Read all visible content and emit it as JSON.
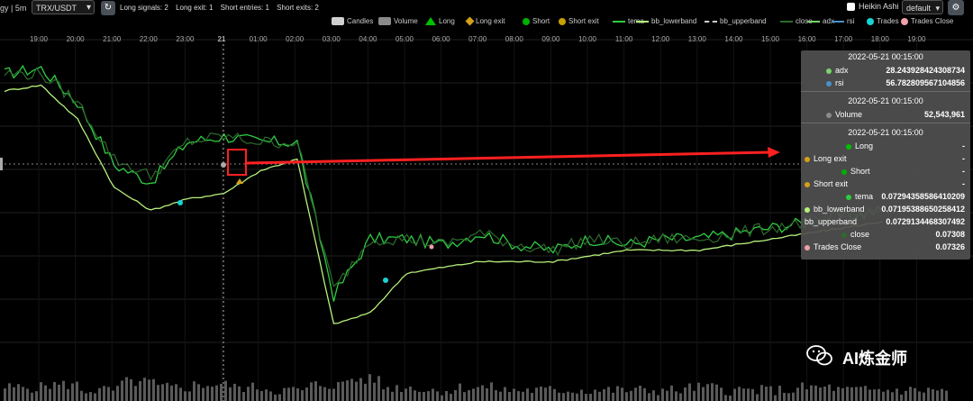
{
  "topbar": {
    "strategy_fragment": "gy | 5m",
    "pair": "TRX/USDT",
    "stats": [
      "Long signals: 2",
      "Long exit: 1",
      "Short entries: 1",
      "Short exits: 2"
    ],
    "heikin_label": "Heikin Ashi",
    "theme_select": "default"
  },
  "legend": [
    {
      "label": "Candles",
      "color": "#d0d0d0",
      "kind": "box"
    },
    {
      "label": "Volume",
      "color": "#8a8a8a",
      "kind": "box"
    },
    {
      "label": "Long",
      "color": "#00c000",
      "kind": "tri"
    },
    {
      "label": "Long exit",
      "color": "#d4a017",
      "kind": "diamond"
    },
    {
      "label": "Short",
      "color": "#00b000",
      "kind": "circle"
    },
    {
      "label": "Short exit",
      "color": "#c8a000",
      "kind": "circle"
    },
    {
      "label": "tema",
      "color": "#2ecc40",
      "kind": "line"
    },
    {
      "label": "bb_lowerband",
      "color": "#b6f07a",
      "kind": "line"
    },
    {
      "label": "bb_upperband",
      "color": "#cccccc",
      "kind": "dash"
    },
    {
      "label": "close",
      "color": "#2d6a2d",
      "kind": "line"
    },
    {
      "label": "adx",
      "color": "#7ad36b",
      "kind": "line"
    },
    {
      "label": "rsi",
      "color": "#4a90c8",
      "kind": "line"
    },
    {
      "label": "Trades",
      "color": "#19d3d3",
      "kind": "circle"
    },
    {
      "label": "Trades Close",
      "color": "#f0a0a8",
      "kind": "circle"
    }
  ],
  "time_axis": [
    "19:00",
    "20:00",
    "21:00",
    "22:00",
    "23:00",
    "21",
    "01:00",
    "02:00",
    "03:00",
    "04:00",
    "05:00",
    "06:00",
    "07:00",
    "08:00",
    "09:00",
    "10:00",
    "11:00",
    "12:00",
    "13:00",
    "14:00",
    "15:00",
    "16:00",
    "17:00",
    "18:00",
    "19:00"
  ],
  "tooltip": {
    "sections": [
      {
        "timestamp": "2022-05-21 00:15:00",
        "rows": [
          {
            "label": "adx",
            "value": "28.243928424308734",
            "color": "#7ad36b"
          },
          {
            "label": "rsi",
            "value": "56.782809567104856",
            "color": "#4a90c8"
          }
        ]
      },
      {
        "timestamp": "2022-05-21 00:15:00",
        "rows": [
          {
            "label": "Volume",
            "value": "52,543,961",
            "color": "#8a8a8a"
          }
        ]
      },
      {
        "timestamp": "2022-05-21 00:15:00",
        "rows": [
          {
            "label": "Long",
            "value": "-",
            "color": "#00c000"
          },
          {
            "label": "Long exit",
            "value": "-",
            "color": "#d4a017"
          },
          {
            "label": "Short",
            "value": "-",
            "color": "#00b000"
          },
          {
            "label": "Short exit",
            "value": "-",
            "color": "#d4a017"
          },
          {
            "label": "tema",
            "value": "0.07294358586410209",
            "color": "#2ecc40"
          },
          {
            "label": "bb_lowerband",
            "value": "0.07195388650258412",
            "color": "#b6f07a"
          },
          {
            "label": "bb_upperband",
            "value": "0.0729134468307492",
            "color": ""
          },
          {
            "label": "close",
            "value": "0.07308",
            "color": "#2d6a2d"
          },
          {
            "label": "Trades Close",
            "value": "0.07326",
            "color": "#f0a0a8"
          }
        ]
      }
    ]
  },
  "watermark": "AI炼金师",
  "chart_data": {
    "type": "line",
    "x_labels": [
      "19:00",
      "20:00",
      "21:00",
      "22:00",
      "23:00",
      "21",
      "01:00",
      "02:00",
      "03:00",
      "04:00",
      "05:00",
      "06:00",
      "07:00",
      "08:00",
      "09:00",
      "10:00",
      "11:00",
      "12:00",
      "13:00",
      "14:00",
      "15:00",
      "16:00",
      "17:00",
      "18:00",
      "19:00"
    ],
    "series": [
      {
        "name": "tema",
        "color": "#2ecc40",
        "values": [
          0.0741,
          0.0742,
          0.0736,
          0.0725,
          0.0722,
          0.0729,
          0.073,
          0.0729,
          0.0729,
          0.0702,
          0.0712,
          0.0712,
          0.0711,
          0.0713,
          0.0711,
          0.071,
          0.0712,
          0.0711,
          0.0712,
          0.0712,
          0.0713,
          0.0714,
          0.0715,
          0.0716,
          0.0717
        ]
      },
      {
        "name": "bb_lowerband",
        "color": "#b6f07a",
        "values": [
          0.0738,
          0.0739,
          0.0733,
          0.0721,
          0.0717,
          0.0719,
          0.072,
          0.0724,
          0.0726,
          0.0697,
          0.0699,
          0.0706,
          0.0707,
          0.0708,
          0.0708,
          0.0708,
          0.0709,
          0.071,
          0.071,
          0.071,
          0.0711,
          0.0712,
          0.0713,
          0.0714,
          0.0715
        ]
      },
      {
        "name": "close",
        "color": "#2d6a2d",
        "values": [
          0.0741,
          0.0741,
          0.0736,
          0.0726,
          0.0723,
          0.0729,
          0.073,
          0.0729,
          0.0729,
          0.0703,
          0.0712,
          0.0712,
          0.0711,
          0.0713,
          0.0711,
          0.071,
          0.0712,
          0.0711,
          0.0712,
          0.0712,
          0.0713,
          0.0714,
          0.0715,
          0.0716,
          0.0717
        ]
      }
    ],
    "volume": [
      3,
      4,
      2,
      5,
      3,
      4,
      3,
      2,
      4,
      6,
      3,
      2,
      3,
      2,
      2,
      2,
      2,
      2,
      3,
      2,
      2,
      3,
      2,
      2,
      2
    ],
    "crosshair_label": "21",
    "marker_label": "2022-05-21 00:15:00"
  }
}
